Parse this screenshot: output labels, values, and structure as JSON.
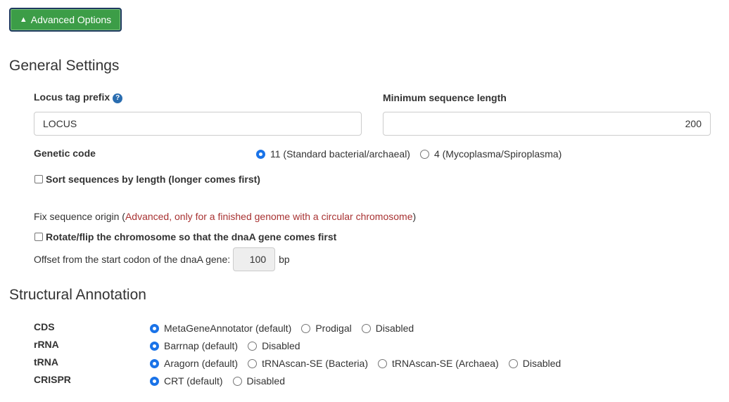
{
  "advanced_button": {
    "icon": "triangle-up-icon",
    "label": "Advanced Options",
    "color": "#3c9d47"
  },
  "general": {
    "title": "General Settings",
    "locus_tag": {
      "label": "Locus tag prefix",
      "icon": "question-circle-icon",
      "value": "LOCUS"
    },
    "min_length": {
      "label": "Minimum sequence length",
      "value": "200"
    },
    "genetic_code": {
      "label": "Genetic code",
      "options": [
        {
          "label": "11 (Standard bacterial/archaeal)",
          "selected": true
        },
        {
          "label": "4 (Mycoplasma/Spiroplasma)",
          "selected": false
        }
      ]
    },
    "sort_sequences": {
      "label": "Sort sequences by length (longer comes first)",
      "checked": false
    },
    "fix_origin": {
      "label": "Fix sequence origin (",
      "note": "Advanced, only for a finished genome with a circular chromosome",
      "close": ")",
      "note_color": "#a83232"
    },
    "rotate": {
      "label": "Rotate/flip the chromosome so that the dnaA gene comes first",
      "checked": false
    },
    "offset": {
      "label": "Offset from the start codon of the dnaA gene:",
      "value": "100",
      "unit": "bp"
    }
  },
  "structural": {
    "title": "Structural Annotation",
    "rows": [
      {
        "label": "CDS",
        "options": [
          "MetaGeneAnnotator (default)",
          "Prodigal",
          "Disabled"
        ],
        "selected": 0
      },
      {
        "label": "rRNA",
        "options": [
          "Barrnap (default)",
          "Disabled"
        ],
        "selected": 0
      },
      {
        "label": "tRNA",
        "options": [
          "Aragorn (default)",
          "tRNAscan-SE (Bacteria)",
          "tRNAscan-SE (Archaea)",
          "Disabled"
        ],
        "selected": 0
      },
      {
        "label": "CRISPR",
        "options": [
          "CRT (default)",
          "Disabled"
        ],
        "selected": 0
      }
    ]
  }
}
